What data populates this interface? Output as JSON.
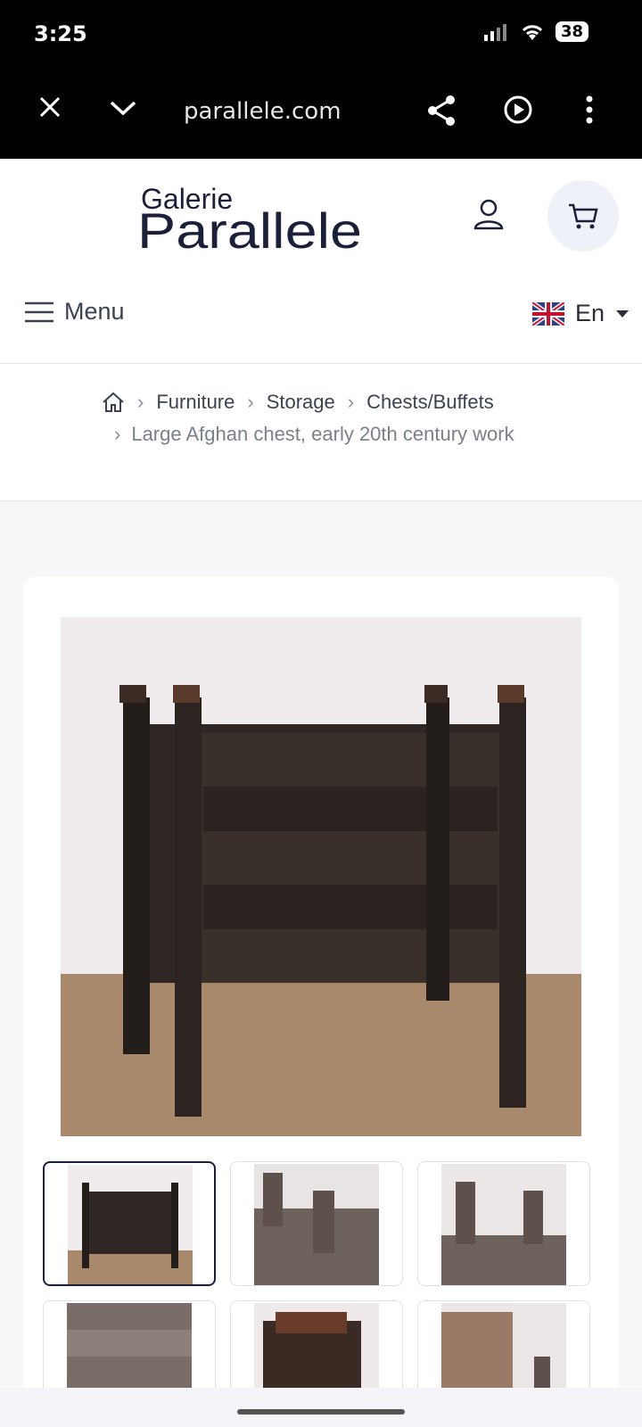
{
  "status": {
    "time": "3:25",
    "battery": "38"
  },
  "browser": {
    "url": "parallele.com"
  },
  "header": {
    "logo_top": "Galerie",
    "logo_bottom": "Parallele"
  },
  "menu": {
    "label": "Menu",
    "language": "En"
  },
  "breadcrumb": {
    "items": [
      "Furniture",
      "Storage",
      "Chests/Buffets"
    ],
    "current": "Large Afghan chest, early 20th century work"
  },
  "colors": {
    "brand": "#1b1f3a",
    "text": "#3b4250",
    "muted": "#7a808c",
    "cart_bg": "#eef2f8"
  },
  "icons": [
    "close-icon",
    "chevron-down-icon",
    "share-icon",
    "play-icon",
    "more-icon",
    "user-icon",
    "cart-icon",
    "hamburger-icon",
    "uk-flag-icon",
    "caret-down-icon",
    "home-icon"
  ]
}
